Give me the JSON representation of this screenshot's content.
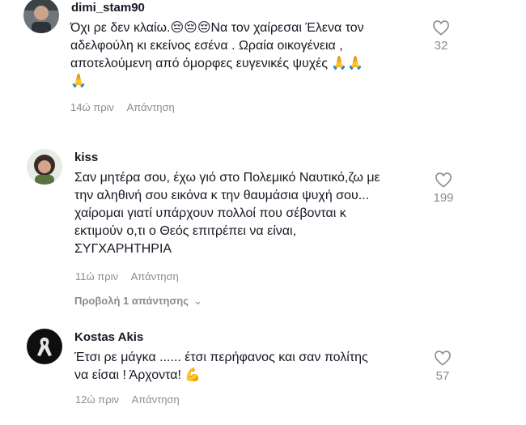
{
  "comments": [
    {
      "username": "dimi_stam90",
      "lines": [
        "Όχι ρε δεν κλαίω.😔😔😔Να τον χαίρεσαι Έλενα τον",
        "αδελφούλη κι εκείνος εσένα . Ωραία οικογένεια ,",
        "αποτελούμενη από όμορφες ευγενικές ψυχές 🙏🙏",
        "🙏"
      ],
      "time": "14ώ πριν",
      "reply_label": "Απάντηση",
      "likes": "32",
      "avatar_icon": "user-photo-avatar"
    },
    {
      "username": "kiss",
      "lines": [
        "Σαν μητέρα σου, έχω γιό στο Πολεμικό Ναυτικό,ζω με",
        "την αληθινή σου εικόνα κ την θαυμάσια ψυχή σου...",
        "χαίρομαι γιατί υπάρχουν πολλοί που σέβονται κ",
        "εκτιμούν ο,τι ο Θεός επιτρέπει να είναι,",
        "ΣΥΓΧΑΡΗΤΗΡΙΑ"
      ],
      "time": "11ώ πριν",
      "reply_label": "Απάντηση",
      "likes": "199",
      "view_replies": "Προβολή 1 απάντησης",
      "avatar_icon": "user-photo-avatar"
    },
    {
      "username": "Kostas Akis",
      "lines": [
        "Έτσι ρε μάγκα ...... έτσι περήφανος και σαν πολίτης",
        "να είσαι ! Άρχοντα! 💪"
      ],
      "time": "12ώ πριν",
      "reply_label": "Απάντηση",
      "likes": "57",
      "avatar_icon": "black-ribbon-avatar"
    }
  ],
  "icons": {
    "like": "heart-outline-icon",
    "chevron": "chevron-down-icon"
  },
  "colors": {
    "text": "#161823",
    "muted": "#8a8b91"
  }
}
